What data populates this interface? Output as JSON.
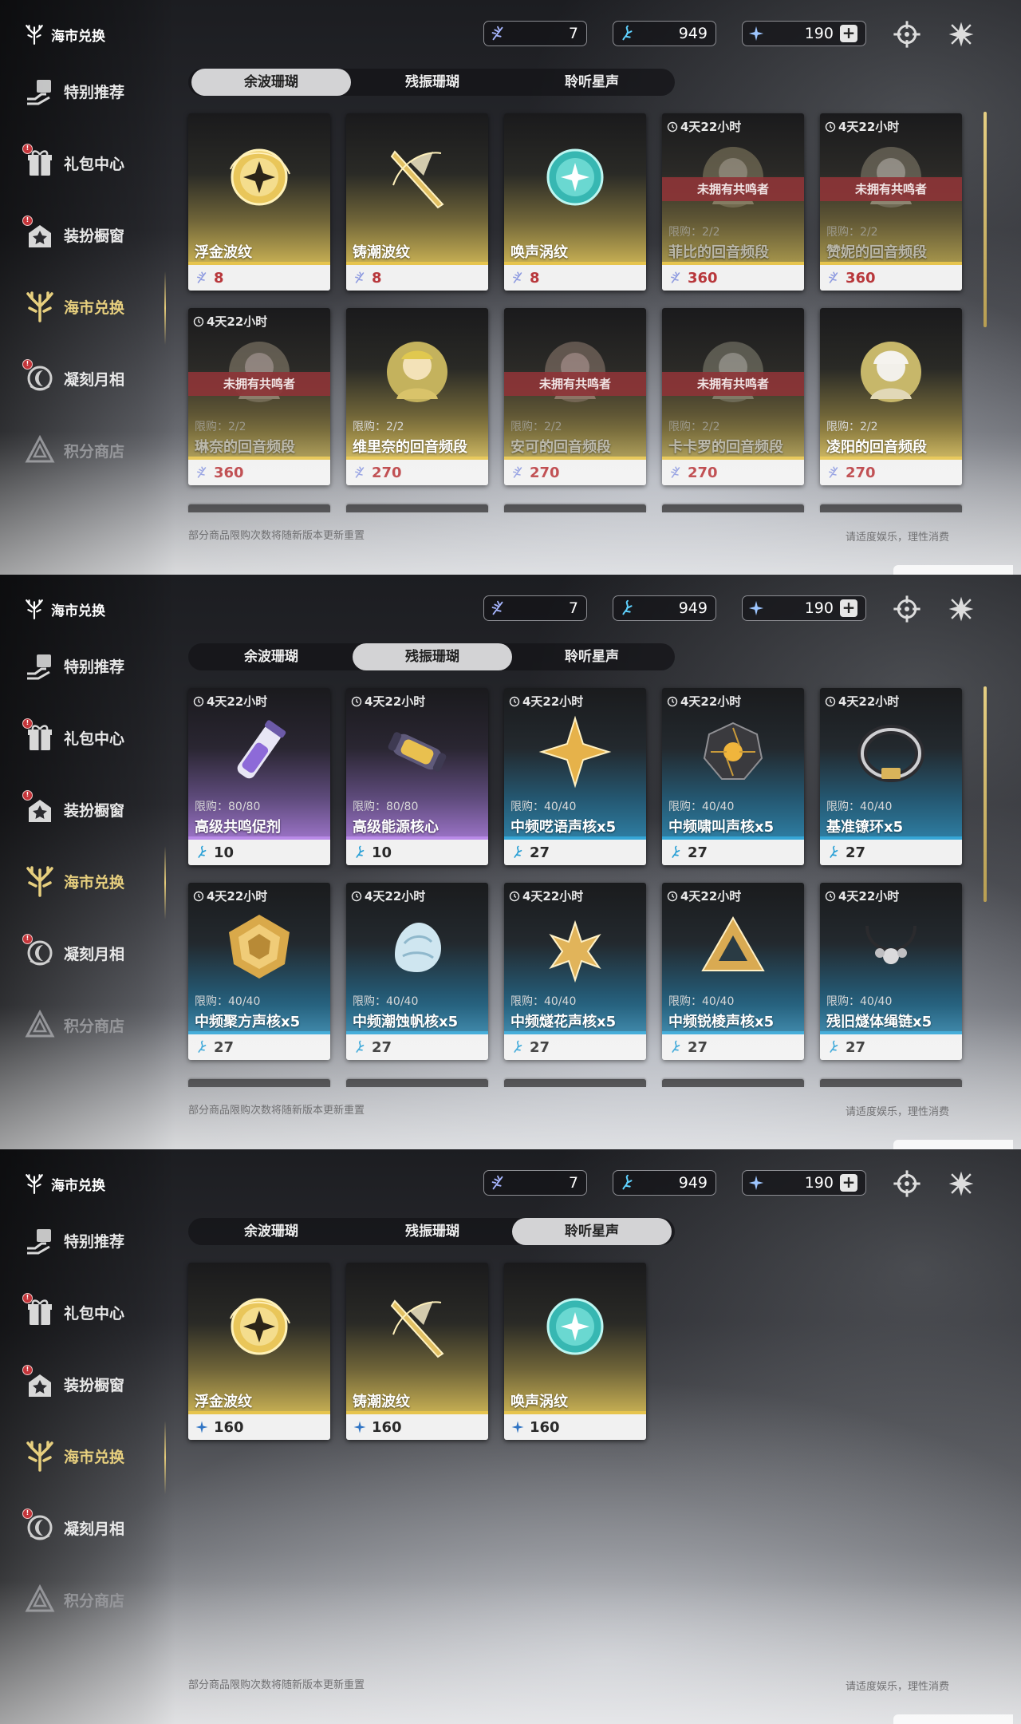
{
  "page_title": "海市兑换",
  "currencies": {
    "c1": "7",
    "c2": "949",
    "c3": "190",
    "plus": "+"
  },
  "sidebar": [
    {
      "label": "特别推荐",
      "icon": "gift-hand-icon"
    },
    {
      "label": "礼包中心",
      "icon": "giftbox-icon",
      "badge": "!"
    },
    {
      "label": "装扮橱窗",
      "icon": "wardrobe-icon",
      "badge": "!"
    },
    {
      "label": "海市兑换",
      "icon": "coral-icon",
      "active": true
    },
    {
      "label": "凝刻月相",
      "icon": "moon-icon",
      "badge": "!"
    },
    {
      "label": "积分商店",
      "icon": "triangle-icon"
    }
  ],
  "tabs": [
    "余波珊瑚",
    "残振珊瑚",
    "聆听星声"
  ],
  "footer": {
    "left": "部分商品限购次数将随新版本更新重置",
    "right": "请适度娱乐，理性消费"
  },
  "panel1": {
    "cards": [
      {
        "name": "浮金波纹",
        "price": "8"
      },
      {
        "name": "铸潮波纹",
        "price": "8"
      },
      {
        "name": "唤声涡纹",
        "price": "8"
      },
      {
        "timer": "4天22小时",
        "tag": "未拥有共鸣者",
        "limit": "限购：2/2",
        "name": "菲比的回音频段",
        "price": "360"
      },
      {
        "timer": "4天22小时",
        "tag": "未拥有共鸣者",
        "limit": "限购：2/2",
        "name": "赞妮的回音频段",
        "price": "360"
      },
      {
        "timer": "4天22小时",
        "tag": "未拥有共鸣者",
        "limit": "限购：2/2",
        "name": "琳奈的回音频段",
        "price": "360"
      },
      {
        "limit": "限购：2/2",
        "name": "维里奈的回音频段",
        "price": "270"
      },
      {
        "tag": "未拥有共鸣者",
        "limit": "限购：2/2",
        "name": "安可的回音频段",
        "price": "270"
      },
      {
        "tag": "未拥有共鸣者",
        "limit": "限购：2/2",
        "name": "卡卡罗的回音频段",
        "price": "270"
      },
      {
        "limit": "限购：2/2",
        "name": "凌阳的回音频段",
        "price": "270"
      }
    ]
  },
  "panel2": {
    "cards": [
      {
        "timer": "4天22小时",
        "limit": "限购：80/80",
        "name": "高级共鸣促剂",
        "price": "10"
      },
      {
        "timer": "4天22小时",
        "limit": "限购：80/80",
        "name": "高级能源核心",
        "price": "10"
      },
      {
        "timer": "4天22小时",
        "limit": "限购：40/40",
        "name": "中频呓语声核x5",
        "price": "27"
      },
      {
        "timer": "4天22小时",
        "limit": "限购：40/40",
        "name": "中频啸叫声核x5",
        "price": "27"
      },
      {
        "timer": "4天22小时",
        "limit": "限购：40/40",
        "name": "基准镣环x5",
        "price": "27"
      },
      {
        "timer": "4天22小时",
        "limit": "限购：40/40",
        "name": "中频聚方声核x5",
        "price": "27"
      },
      {
        "timer": "4天22小时",
        "limit": "限购：40/40",
        "name": "中频潮蚀帆核x5",
        "price": "27"
      },
      {
        "timer": "4天22小时",
        "limit": "限购：40/40",
        "name": "中频燧花声核x5",
        "price": "27"
      },
      {
        "timer": "4天22小时",
        "limit": "限购：40/40",
        "name": "中频锐棱声核x5",
        "price": "27"
      },
      {
        "timer": "4天22小时",
        "limit": "限购：40/40",
        "name": "残旧燧体绳链x5",
        "price": "27"
      }
    ]
  },
  "panel3": {
    "cards": [
      {
        "name": "浮金波纹",
        "price": "160"
      },
      {
        "name": "铸潮波纹",
        "price": "160"
      },
      {
        "name": "唤声涡纹",
        "price": "160"
      }
    ]
  },
  "colors": {
    "accent_gold": "#e6c44e",
    "active_text": "#e7cf7e",
    "price_red": "#b8373b",
    "tag_red": "#8c3437"
  }
}
